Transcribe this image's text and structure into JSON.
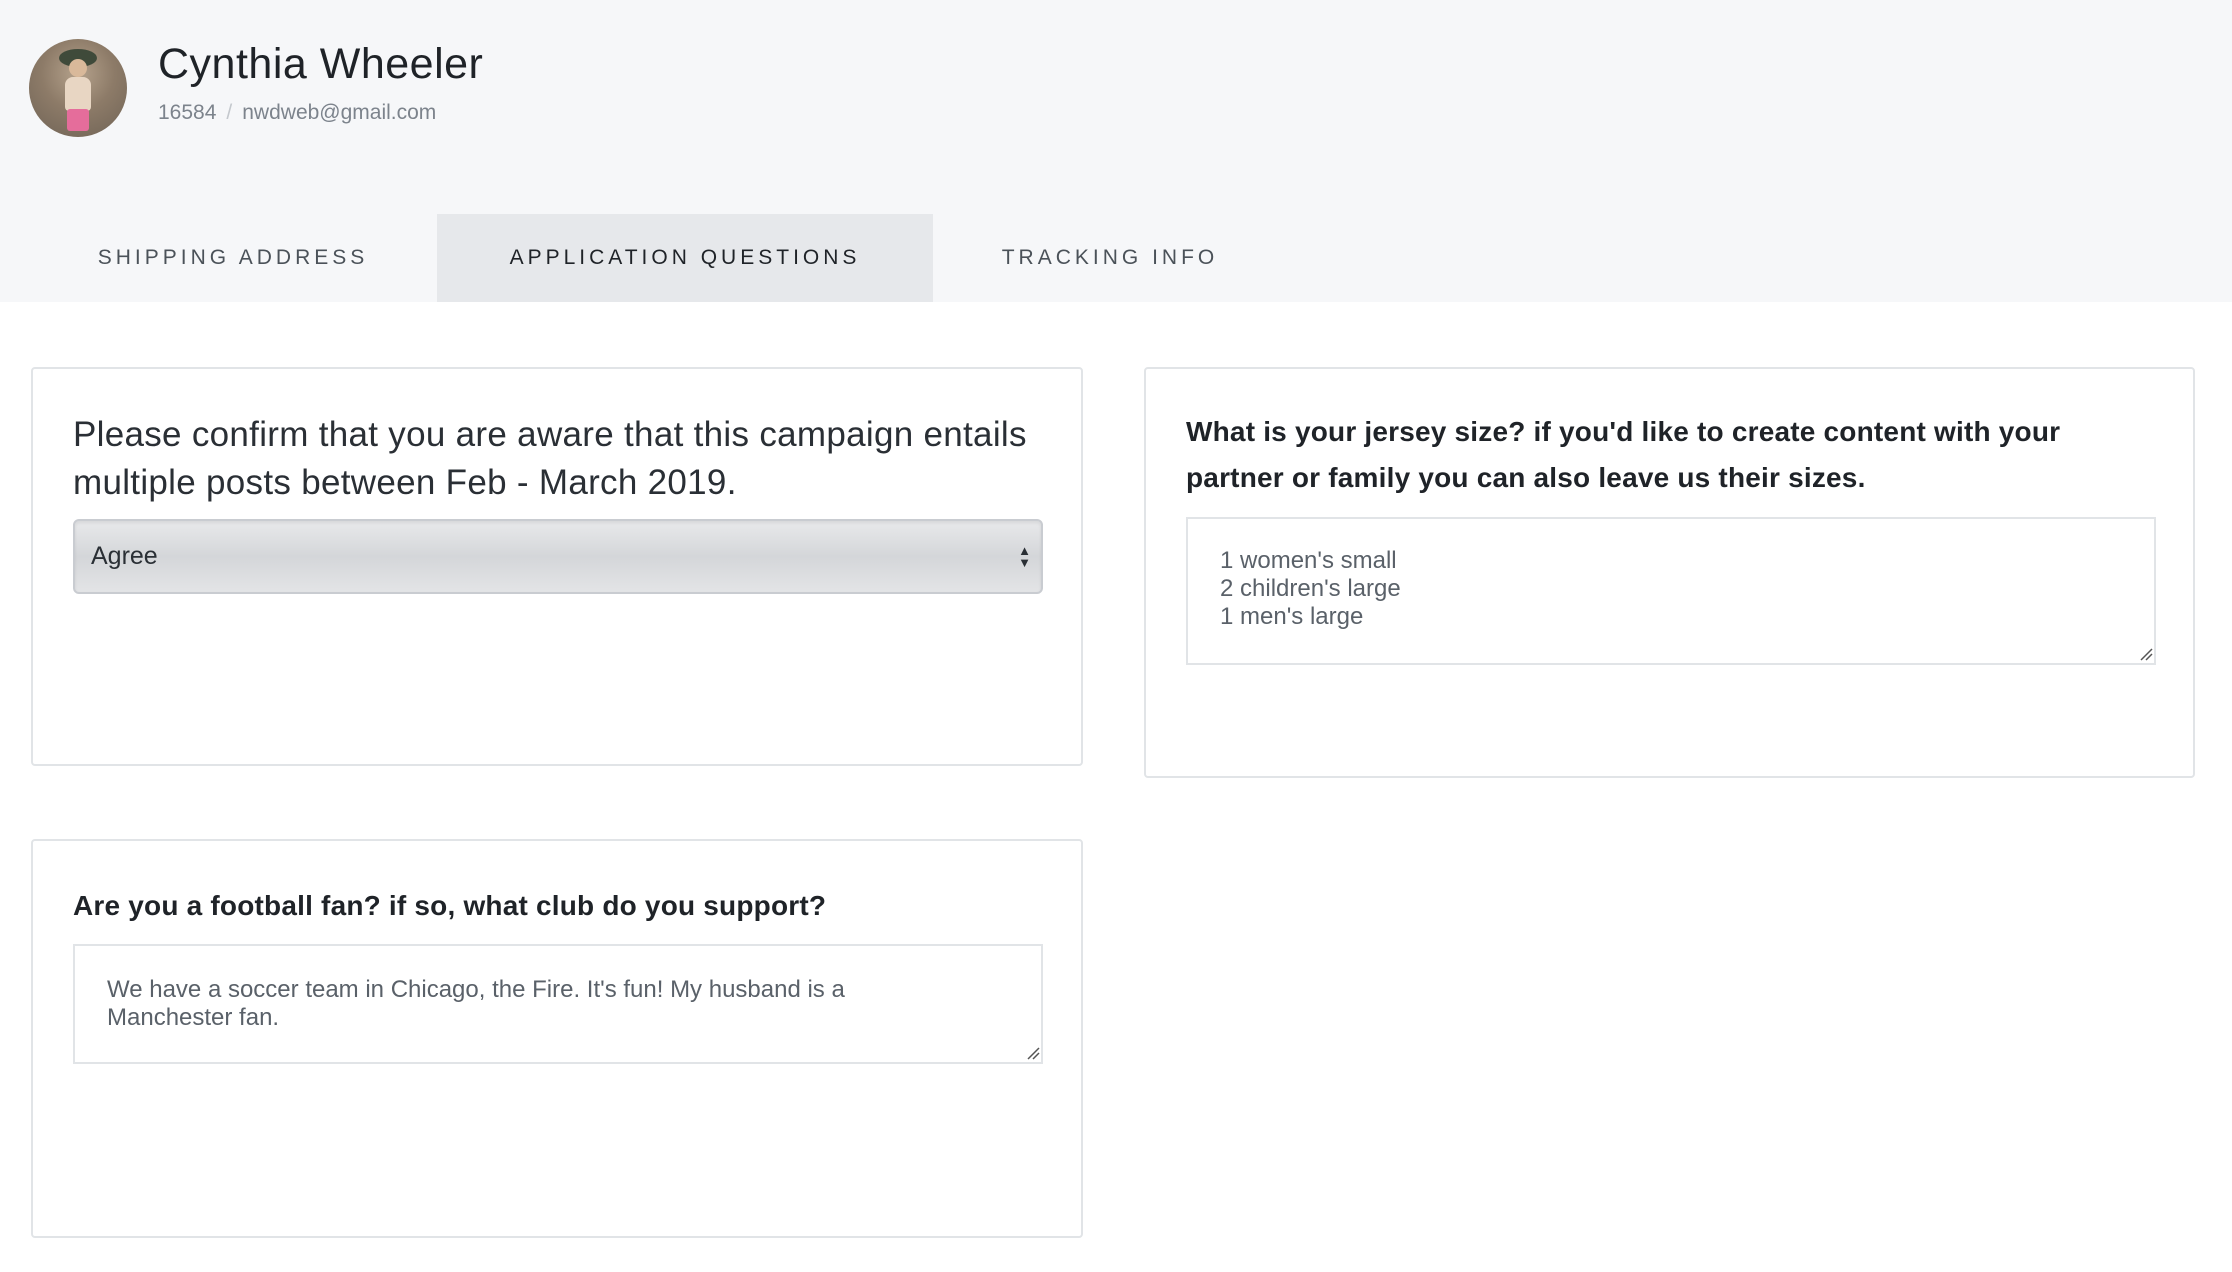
{
  "profile": {
    "name": "Cynthia Wheeler",
    "id": "16584",
    "separator": "/",
    "email": "nwdweb@gmail.com"
  },
  "tabs": [
    {
      "label": "SHIPPING ADDRESS",
      "active": false
    },
    {
      "label": "APPLICATION QUESTIONS",
      "active": true
    },
    {
      "label": "TRACKING INFO",
      "active": false
    }
  ],
  "questions": {
    "campaign": {
      "question": "Please confirm that you are aware that this campaign entails multiple posts between Feb - March 2019.",
      "selected": "Agree",
      "arrow_up": "▲",
      "arrow_down": "▼"
    },
    "jersey": {
      "question": "What is your jersey size? if you'd like to create content with your partner or family you can also leave us their sizes.",
      "answer": "1 women's small\n2 children's large\n1 men's large"
    },
    "football": {
      "question": "Are you a football fan? if so, what club do you support?",
      "answer": "We have a soccer team in Chicago, the Fire. It's fun! My husband is a\nManchester fan."
    }
  },
  "colors": {
    "header_bg": "#f6f7f9",
    "active_tab_bg": "#e6e8eb",
    "card_border": "#e1e4e7"
  }
}
